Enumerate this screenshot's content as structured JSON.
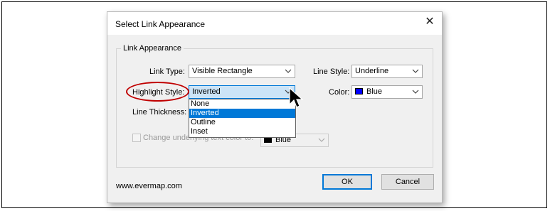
{
  "dialog": {
    "title": "Select Link Appearance",
    "close_icon": "close-icon",
    "group_label": "Link Appearance",
    "link_type": {
      "label": "Link Type:",
      "value": "Visible Rectangle"
    },
    "line_style": {
      "label": "Line Style:",
      "value": "Underline"
    },
    "highlight_style": {
      "label": "Highlight Style:",
      "value": "Inverted",
      "options": [
        "None",
        "Inverted",
        "Outline",
        "Inset"
      ],
      "selected_option": "Inverted"
    },
    "color": {
      "label": "Color:",
      "value": "Blue",
      "swatch": "#0000ff"
    },
    "line_thickness": {
      "label": "Line Thickness:"
    },
    "change_text_color": {
      "label": "Change underlying text color to:",
      "value": "Blue",
      "swatch": "#000000",
      "checked": false,
      "enabled": false
    },
    "footer": {
      "website": "www.evermap.com",
      "ok_label": "OK",
      "cancel_label": "Cancel"
    }
  },
  "annotations": {
    "highlight_circle_color": "#c00000",
    "cursor_icon": "arrow-cursor-icon"
  },
  "colors": {
    "dialog_bg": "#f0f0f0",
    "accent": "#0078d7",
    "selection_bg": "#cce4f7"
  }
}
